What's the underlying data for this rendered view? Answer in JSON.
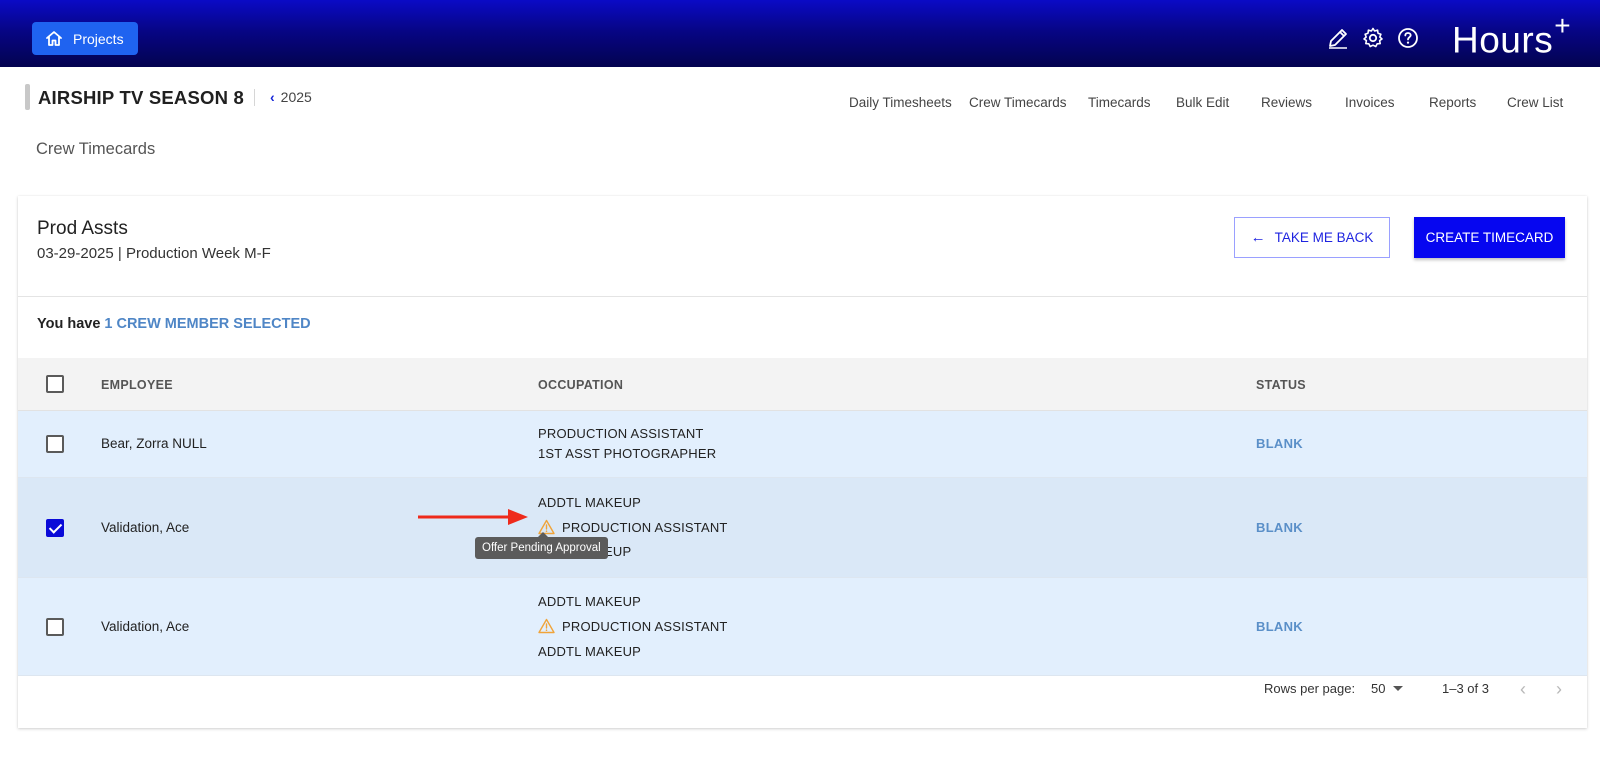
{
  "topbar": {
    "projects_label": "Projects",
    "brand": "Hours",
    "brand_plus": "+"
  },
  "header": {
    "project_title": "AIRSHIP TV SEASON 8",
    "year": "2025",
    "nav": [
      "Daily Timesheets",
      "Crew Timecards",
      "Timecards",
      "Bulk Edit",
      "Reviews",
      "Invoices",
      "Reports",
      "Crew List"
    ],
    "page_heading": "Crew Timecards"
  },
  "card": {
    "title": "Prod Assts",
    "subtitle": "03-29-2025 | Production Week M-F",
    "back_label": "TAKE ME BACK",
    "create_label": "CREATE TIMECARD",
    "selection_prefix": "You have",
    "selection_count": "1 CREW MEMBER SELECTED"
  },
  "table": {
    "headers": {
      "employee": "EMPLOYEE",
      "occupation": "OCCUPATION",
      "status": "STATUS"
    },
    "rows": [
      {
        "employee": "Bear, Zorra NULL",
        "checked": false,
        "occupations": [
          "PRODUCTION ASSISTANT",
          "1ST ASST PHOTOGRAPHER"
        ],
        "status": "BLANK"
      },
      {
        "employee": "Validation, Ace",
        "checked": true,
        "occupations": [
          "ADDTL MAKEUP",
          "PRODUCTION ASSISTANT",
          "ADDTL MAKEUP"
        ],
        "warning_index": 1,
        "status": "BLANK"
      },
      {
        "employee": "Validation, Ace",
        "checked": false,
        "occupations": [
          "ADDTL MAKEUP",
          "PRODUCTION ASSISTANT",
          "ADDTL MAKEUP"
        ],
        "warning_index": 1,
        "status": "BLANK"
      }
    ],
    "tooltip": "Offer Pending Approval",
    "obscured_partial_text": "EUP"
  },
  "footer": {
    "rows_per_page_label": "Rows per page:",
    "rows_per_page_value": "50",
    "range": "1–3 of 3"
  },
  "colors": {
    "accent": "#0606f0",
    "status_blue": "#5a8fc8",
    "warning": "#f0a43a",
    "annotation_arrow": "#ee2a1b"
  },
  "icons": [
    "home-icon",
    "pencil-icon",
    "gear-icon",
    "help-icon",
    "arrow-left-icon",
    "warning-icon",
    "chevron-left-icon",
    "chevron-right-icon",
    "caret-down-icon"
  ]
}
